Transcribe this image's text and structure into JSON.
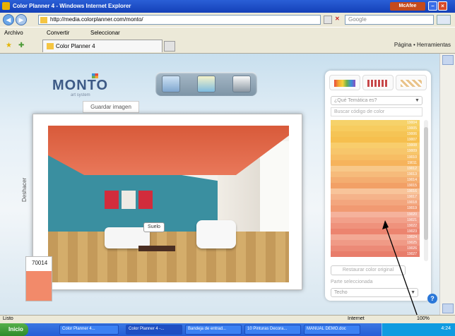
{
  "window": {
    "title": "Color Planner 4 - Windows Internet Explorer",
    "mcafee": "McAfee"
  },
  "browser": {
    "url": "http://media.colorplanner.com/monto/",
    "search_placeholder": "Google",
    "menu_archivo": "Archivo",
    "menu_convertir": "Convertir",
    "menu_seleccionar": "Seleccionar",
    "tab_title": "Color Planner 4",
    "tools": "Página  •  Herramientas"
  },
  "app": {
    "logo": "MONTO",
    "logo_sub": "art system",
    "save_image": "Guardar imagen",
    "deshacer": "Deshacer",
    "suelo": "Suelo",
    "swatch_code": "70014",
    "swatch_color": "#f28a6a",
    "collection_placeholder": "¿Qué Temática es?",
    "search_placeholder": "Buscar código de color",
    "restore_button": "Restaurar color original",
    "part_label": "Parte seleccionada",
    "part_select": "Techo",
    "help": "?"
  },
  "colors": [
    {
      "hex": "#f6d26a",
      "code": "19004"
    },
    {
      "hex": "#f7cc5f",
      "code": "19005"
    },
    {
      "hex": "#f5c455",
      "code": "19006"
    },
    {
      "hex": "#f6bf4e",
      "code": "19007"
    },
    {
      "hex": "#f8cd6c",
      "code": "19008"
    },
    {
      "hex": "#f7c66b",
      "code": "19009"
    },
    {
      "hex": "#f7bd63",
      "code": "19010"
    },
    {
      "hex": "#f6b35c",
      "code": "19011"
    },
    {
      "hex": "#f8c889",
      "code": "19012"
    },
    {
      "hex": "#f6bb7b",
      "code": "19013"
    },
    {
      "hex": "#f4ad70",
      "code": "19014"
    },
    {
      "hex": "#f2a066",
      "code": "19015"
    },
    {
      "hex": "#f8c49a",
      "code": "19016"
    },
    {
      "hex": "#f5b38a",
      "code": "19017"
    },
    {
      "hex": "#f3a67e",
      "code": "19018"
    },
    {
      "hex": "#f19a72",
      "code": "19019"
    },
    {
      "hex": "#f5b29c",
      "code": "19020"
    },
    {
      "hex": "#f2a08a",
      "code": "19021"
    },
    {
      "hex": "#ef927c",
      "code": "19022"
    },
    {
      "hex": "#ec846f",
      "code": "19023"
    },
    {
      "hex": "#f3a995",
      "code": "19024"
    },
    {
      "hex": "#f09a86",
      "code": "19025"
    },
    {
      "hex": "#ec8a77",
      "code": "19026"
    },
    {
      "hex": "#e87d6b",
      "code": "19027"
    }
  ],
  "status": {
    "left": "Listo",
    "zone": "Internet",
    "zoom": "100%"
  },
  "taskbar": {
    "start": "Inicio",
    "tasks": [
      "Color Planner 4...",
      "Color Planner 4 -...",
      "Bandeja de entrad...",
      "10 Pinturas Decora...",
      "MANUAL DEMO.doc"
    ],
    "clock": "4:24"
  }
}
